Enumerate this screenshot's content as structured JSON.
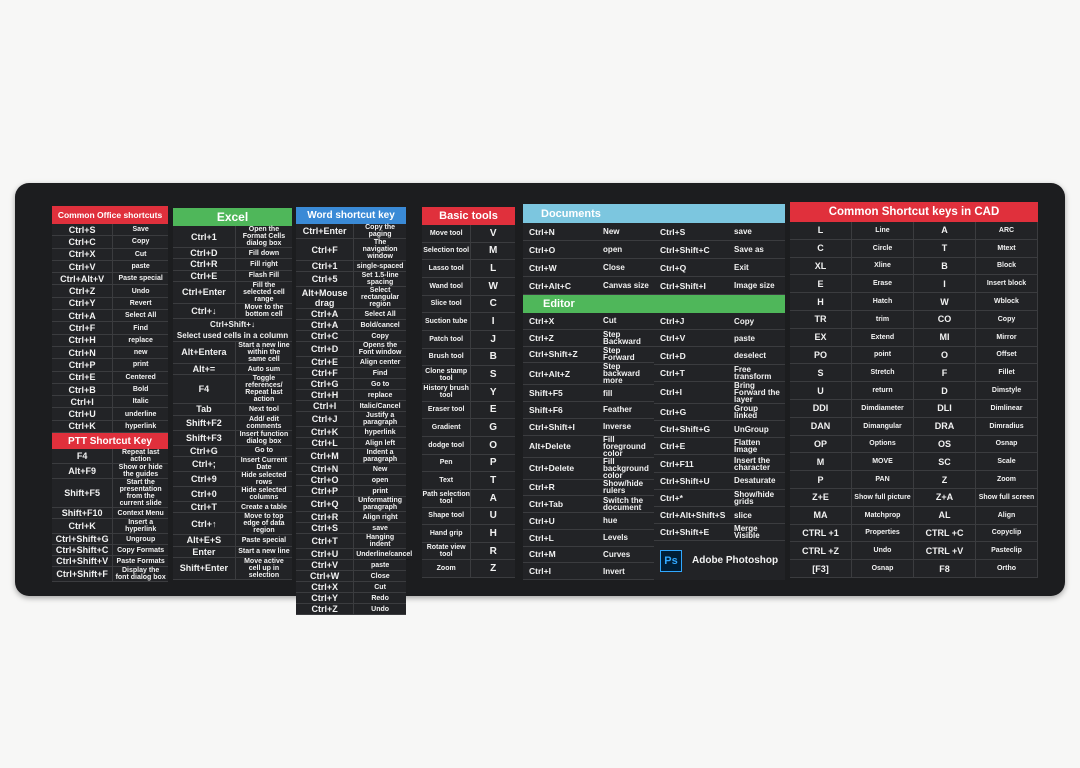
{
  "colors": {
    "red": "#e0303c",
    "green": "#4fb75a",
    "blue": "#3a8ad6",
    "light_blue": "#7cc6df",
    "mat": "#1c1d1f"
  },
  "office": {
    "title": "Common Office shortcuts",
    "rows": [
      [
        "Ctrl+S",
        "Save"
      ],
      [
        "Ctrl+C",
        "Copy"
      ],
      [
        "Ctrl+X",
        "Cut"
      ],
      [
        "Ctrl+V",
        "paste"
      ],
      [
        "Ctrl+Alt+V",
        "Paste special"
      ],
      [
        "Ctrl+Z",
        "Undo"
      ],
      [
        "Ctrl+Y",
        "Revert"
      ],
      [
        "Ctrl+A",
        "Select All"
      ],
      [
        "Ctrl+F",
        "Find"
      ],
      [
        "Ctrl+H",
        "replace"
      ],
      [
        "Ctrl+N",
        "new"
      ],
      [
        "Ctrl+P",
        "print"
      ],
      [
        "Ctrl+E",
        "Centered"
      ],
      [
        "Ctrl+B",
        "Bold"
      ],
      [
        "Ctrl+I",
        "Italic"
      ],
      [
        "Ctrl+U",
        "underline"
      ],
      [
        "Ctrl+K",
        "hyperlink"
      ]
    ]
  },
  "ptt": {
    "title": "PTT Shortcut Key",
    "rows": [
      [
        "F4",
        "Repeat last action"
      ],
      [
        "Alt+F9",
        "Show or hide the guides"
      ],
      [
        "Shift+F5",
        "Start the presentation from the current slide"
      ],
      [
        "Shift+F10",
        "Context Menu"
      ],
      [
        "Ctrl+K",
        "Insert a hyperlink"
      ],
      [
        "Ctrl+Shift+G",
        "Ungroup"
      ],
      [
        "Ctrl+Shift+C",
        "Copy Formats"
      ],
      [
        "Ctrl+Shift+V",
        "Paste Formats"
      ],
      [
        "Ctrl+Shift+F",
        "Display the font dialog box"
      ]
    ]
  },
  "excel": {
    "title": "Excel",
    "rows": [
      [
        "Ctrl+1",
        "Open the Format Cells dialog box"
      ],
      [
        "Ctrl+D",
        "Fill down"
      ],
      [
        "Ctrl+R",
        "Fill right"
      ],
      [
        "Ctrl+E",
        "Flash Fill"
      ],
      [
        "Ctrl+Enter",
        "Fill the selected cell range"
      ],
      [
        "Ctrl+↓",
        "Move to the bottom cell"
      ],
      [
        "Ctrl+Shift+↓",
        "Select used cells in a column"
      ],
      [
        "Alt+Entera",
        "Start a new line within the same cell"
      ],
      [
        "Alt+=",
        "Auto sum"
      ],
      [
        "F4",
        "Toggle references/ Repeat last action"
      ],
      [
        "Tab",
        "Next tool"
      ],
      [
        "Shift+F2",
        "Add/ edit comments"
      ],
      [
        "Shift+F3",
        "Insert function dialog box"
      ],
      [
        "Ctrl+G",
        "Go to"
      ],
      [
        "Ctrl+;",
        "Insert Current Date"
      ],
      [
        "Ctrl+9",
        "Hide selected rows"
      ],
      [
        "Ctrl+0",
        "Hide selected columns"
      ],
      [
        "Ctrl+T",
        "Create a table"
      ],
      [
        "Ctrl+↑",
        "Move to top edge of data region"
      ],
      [
        "Alt+E+S",
        "Paste special"
      ],
      [
        "Enter",
        "Start a new line"
      ],
      [
        "Shift+Enter",
        "Move active cell up in selection"
      ]
    ]
  },
  "word": {
    "title": "Word shortcut key",
    "rows": [
      [
        "Ctrl+Enter",
        "Copy the paging"
      ],
      [
        "Ctrl+F",
        "The navigation window"
      ],
      [
        "Ctrl+1",
        "single-spaced"
      ],
      [
        "Ctrl+5",
        "Set 1.5-line spacing"
      ],
      [
        "Alt+Mouse drag",
        "Select rectangular region"
      ],
      [
        "Ctrl+A",
        "Select All"
      ],
      [
        "Ctrl+A",
        "Bold/cancel"
      ],
      [
        "Ctrl+C",
        "Copy"
      ],
      [
        "Ctrl+D",
        "Opens the Font window"
      ],
      [
        "Ctrl+E",
        "Align center"
      ],
      [
        "Ctrl+F",
        "Find"
      ],
      [
        "Ctrl+G",
        "Go to"
      ],
      [
        "Ctrl+H",
        "replace"
      ],
      [
        "Ctrl+I",
        "Italic/Cancel"
      ],
      [
        "Ctrl+J",
        "Justify a paragraph"
      ],
      [
        "Ctrl+K",
        "hyperlink"
      ],
      [
        "Ctrl+L",
        "Align left"
      ],
      [
        "Ctrl+M",
        "Indent a paragraph"
      ],
      [
        "Ctrl+N",
        "New"
      ],
      [
        "Ctrl+O",
        "open"
      ],
      [
        "Ctrl+P",
        "print"
      ],
      [
        "Ctrl+Q",
        "Unformatting paragraph"
      ],
      [
        "Ctrl+R",
        "Align right"
      ],
      [
        "Ctrl+S",
        "save"
      ],
      [
        "Ctrl+T",
        "Hanging indent"
      ],
      [
        "Ctrl+U",
        "Underline/cancel"
      ],
      [
        "Ctrl+V",
        "paste"
      ],
      [
        "Ctrl+W",
        "Close"
      ],
      [
        "Ctrl+X",
        "Cut"
      ],
      [
        "Ctrl+Y",
        "Redo"
      ],
      [
        "Ctrl+Z",
        "Undo"
      ]
    ]
  },
  "basic": {
    "title": "Basic tools",
    "rows": [
      [
        "Move tool",
        "V"
      ],
      [
        "Selection tool",
        "M"
      ],
      [
        "Lasso tool",
        "L"
      ],
      [
        "Wand tool",
        "W"
      ],
      [
        "Slice tool",
        "C"
      ],
      [
        "Suction tube",
        "I"
      ],
      [
        "Patch tool",
        "J"
      ],
      [
        "Brush tool",
        "B"
      ],
      [
        "Clone stamp tool",
        "S"
      ],
      [
        "History brush tool",
        "Y"
      ],
      [
        "Eraser tool",
        "E"
      ],
      [
        "Gradient",
        "G"
      ],
      [
        "dodge tool",
        "O"
      ],
      [
        "Pen",
        "P"
      ],
      [
        "Text",
        "T"
      ],
      [
        "Path selection tool",
        "A"
      ],
      [
        "Shape tool",
        "U"
      ],
      [
        "Hand grip",
        "H"
      ],
      [
        "Rotate view tool",
        "R"
      ],
      [
        "Zoom",
        "Z"
      ]
    ]
  },
  "documents": {
    "title": "Documents",
    "left": [
      [
        "Ctrl+N",
        "New"
      ],
      [
        "Ctrl+O",
        "open"
      ],
      [
        "Ctrl+W",
        "Close"
      ],
      [
        "Ctrl+Alt+C",
        "Canvas size"
      ]
    ],
    "right": [
      [
        "Ctrl+S",
        "save"
      ],
      [
        "Ctrl+Shift+C",
        "Save as"
      ],
      [
        "Ctrl+Q",
        "Exit"
      ],
      [
        "Ctrl+Shift+I",
        "Image size"
      ]
    ]
  },
  "editor": {
    "title": "Editor",
    "left": [
      [
        "Ctrl+X",
        "Cut"
      ],
      [
        "Ctrl+Z",
        "Step Backward"
      ],
      [
        "Ctrl+Shift+Z",
        "Step Forward"
      ],
      [
        "Ctrl+Alt+Z",
        "Step backward more"
      ],
      [
        "Shift+F5",
        "fill"
      ],
      [
        "Shift+F6",
        "Feather"
      ],
      [
        "Ctrl+Shift+I",
        "Inverse"
      ],
      [
        "Alt+Delete",
        "Fill foreground color"
      ],
      [
        "Ctrl+Delete",
        "Fill background color"
      ],
      [
        "Ctrl+R",
        "Show/hide rulers"
      ],
      [
        "Ctrl+Tab",
        "Switch the document"
      ],
      [
        "Ctrl+U",
        "hue"
      ],
      [
        "Ctrl+L",
        "Levels"
      ],
      [
        "Ctrl+M",
        "Curves"
      ],
      [
        "Ctrl+I",
        "Invert"
      ]
    ],
    "right": [
      [
        "Ctrl+J",
        "Copy"
      ],
      [
        "Ctrl+V",
        "paste"
      ],
      [
        "Ctrl+D",
        "deselect"
      ],
      [
        "Ctrl+T",
        "Free transform"
      ],
      [
        "Ctrl+I",
        "Bring Forward the layer"
      ],
      [
        "Ctrl+G",
        "Group linked"
      ],
      [
        "Ctrl+Shift+G",
        "UnGroup"
      ],
      [
        "Ctrl+E",
        "Flatten Image"
      ],
      [
        "Ctrl+F11",
        "Insert the character"
      ],
      [
        "Ctrl+Shift+U",
        "Desaturate"
      ],
      [
        "Ctrl+*",
        "Show/hide grids"
      ],
      [
        "Ctrl+Alt+Shift+S",
        "slice"
      ],
      [
        "Ctrl+Shift+E",
        "Merge Visible"
      ]
    ],
    "ps_logo": "Ps",
    "ps_name": "Adobe Photoshop"
  },
  "cad": {
    "title": "Common Shortcut keys in CAD",
    "rows": [
      [
        "L",
        "Line",
        "A",
        "ARC"
      ],
      [
        "C",
        "Circle",
        "T",
        "Mtext"
      ],
      [
        "XL",
        "Xline",
        "B",
        "Block"
      ],
      [
        "E",
        "Erase",
        "I",
        "Insert block"
      ],
      [
        "H",
        "Hatch",
        "W",
        "Wblock"
      ],
      [
        "TR",
        "trim",
        "CO",
        "Copy"
      ],
      [
        "EX",
        "Extend",
        "MI",
        "Mirror"
      ],
      [
        "PO",
        "point",
        "O",
        "Offset"
      ],
      [
        "S",
        "Stretch",
        "F",
        "Fillet"
      ],
      [
        "U",
        "return",
        "D",
        "Dimstyle"
      ],
      [
        "DDI",
        "Dimdiameter",
        "DLI",
        "Dimlinear"
      ],
      [
        "DAN",
        "Dimangular",
        "DRA",
        "Dimradius"
      ],
      [
        "OP",
        "Options",
        "OS",
        "Osnap"
      ],
      [
        "M",
        "MOVE",
        "SC",
        "Scale"
      ],
      [
        "P",
        "PAN",
        "Z",
        "Zoom"
      ],
      [
        "Z+E",
        "Show full picture",
        "Z+A",
        "Show full screen"
      ],
      [
        "MA",
        "Matchprop",
        "AL",
        "Align"
      ],
      [
        "CTRL +1",
        "Properties",
        "CTRL +C",
        "Copyclip"
      ],
      [
        "CTRL +Z",
        "Undo",
        "CTRL +V",
        "Pasteclip"
      ],
      [
        "[F3]",
        "Osnap",
        "F8",
        "Ortho"
      ]
    ]
  }
}
